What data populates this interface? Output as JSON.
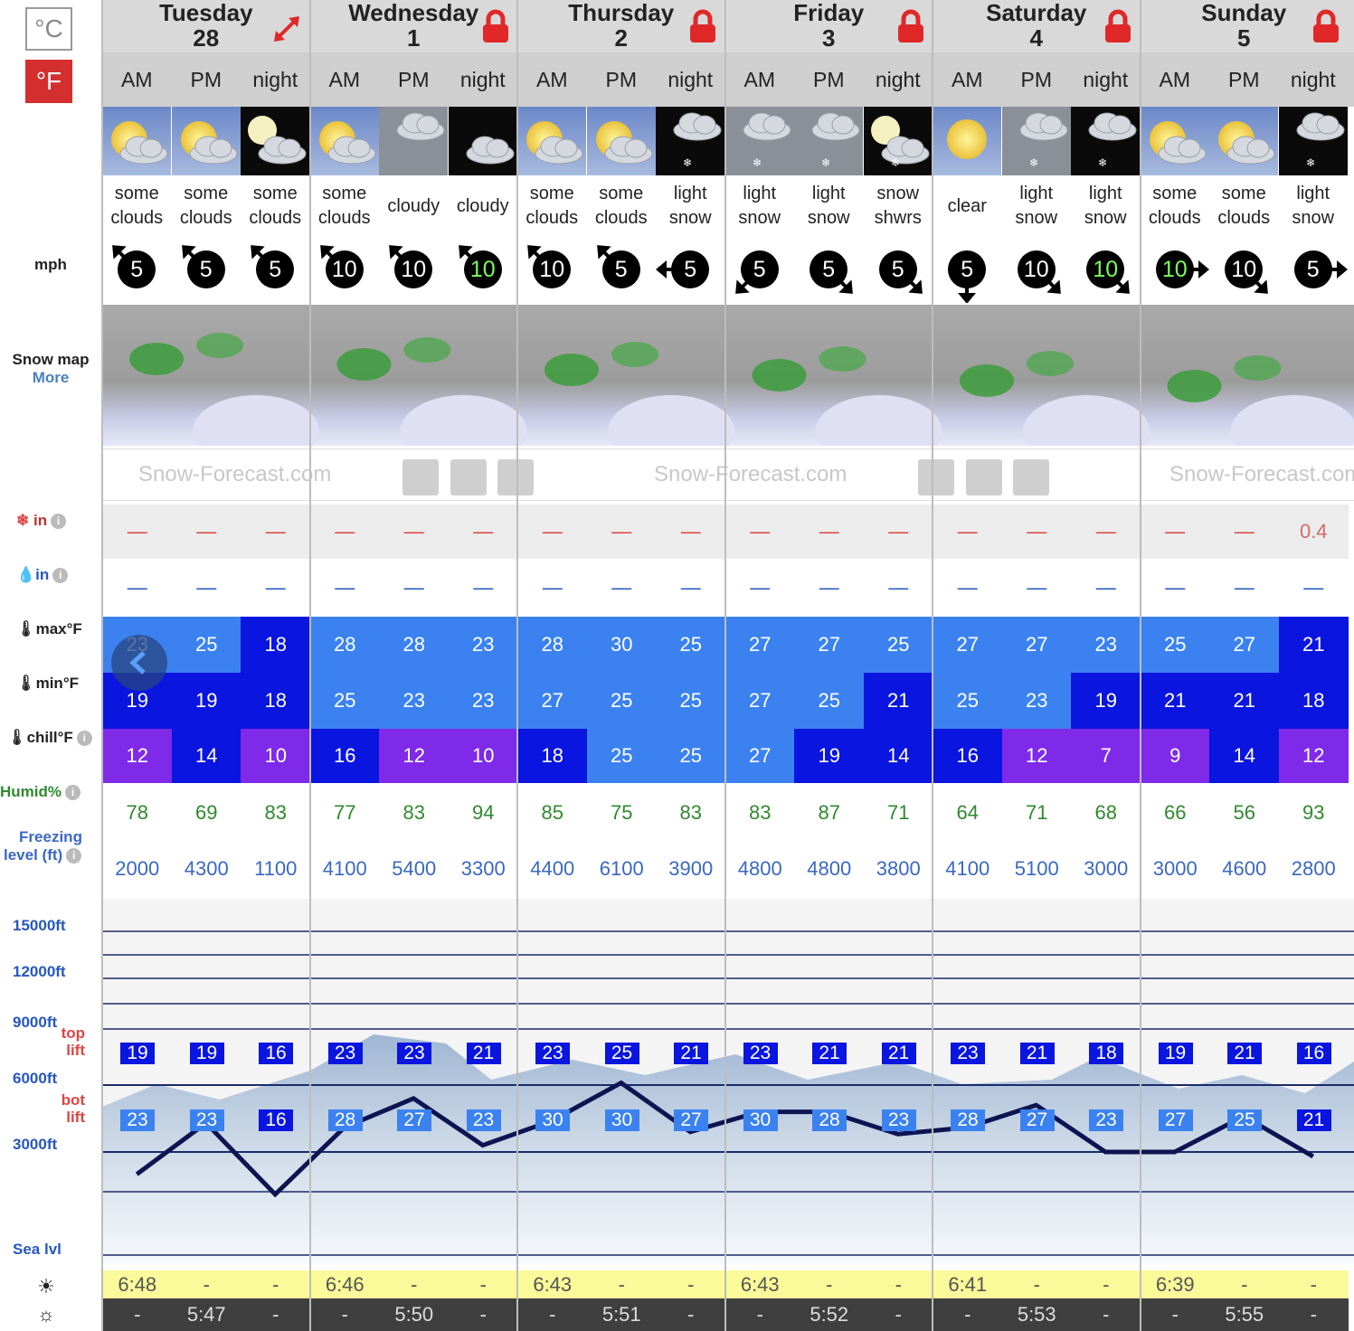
{
  "units": {
    "celsius": "°C",
    "fahrenheit": "°F",
    "active": "F"
  },
  "days": [
    {
      "name": "Tuesday",
      "date": "28",
      "locked": false,
      "expand": true
    },
    {
      "name": "Wednesday",
      "date": "1",
      "locked": true
    },
    {
      "name": "Thursday",
      "date": "2",
      "locked": true
    },
    {
      "name": "Friday",
      "date": "3",
      "locked": true
    },
    {
      "name": "Saturday",
      "date": "4",
      "locked": true
    },
    {
      "name": "Sunday",
      "date": "5",
      "locked": true
    }
  ],
  "periods": [
    "AM",
    "PM",
    "night",
    "AM",
    "PM",
    "night",
    "AM",
    "PM",
    "night",
    "AM",
    "PM",
    "night",
    "AM",
    "PM",
    "night",
    "AM",
    "PM",
    "night"
  ],
  "weather": [
    {
      "l1": "some",
      "l2": "clouds",
      "icon": "sun-clouds-icon"
    },
    {
      "l1": "some",
      "l2": "clouds",
      "icon": "sun-clouds-icon"
    },
    {
      "l1": "some",
      "l2": "clouds",
      "icon": "moon-clouds-icon"
    },
    {
      "l1": "some",
      "l2": "clouds",
      "icon": "sun-clouds-icon"
    },
    {
      "l1": "cloudy",
      "l2": "",
      "icon": "cloud-icon"
    },
    {
      "l1": "cloudy",
      "l2": "",
      "icon": "cloud-night-icon"
    },
    {
      "l1": "some",
      "l2": "clouds",
      "icon": "sun-clouds-icon"
    },
    {
      "l1": "some",
      "l2": "clouds",
      "icon": "sun-clouds-icon"
    },
    {
      "l1": "light",
      "l2": "snow",
      "icon": "snow-cloud-night-icon"
    },
    {
      "l1": "light",
      "l2": "snow",
      "icon": "snow-cloud-icon"
    },
    {
      "l1": "light",
      "l2": "snow",
      "icon": "snow-cloud-icon"
    },
    {
      "l1": "snow",
      "l2": "shwrs",
      "icon": "moon-snow-icon"
    },
    {
      "l1": "clear",
      "l2": "",
      "icon": "sun-icon"
    },
    {
      "l1": "light",
      "l2": "snow",
      "icon": "snow-cloud-icon"
    },
    {
      "l1": "light",
      "l2": "snow",
      "icon": "snow-cloud-night-icon"
    },
    {
      "l1": "some",
      "l2": "clouds",
      "icon": "sun-clouds-icon"
    },
    {
      "l1": "some",
      "l2": "clouds",
      "icon": "sun-clouds-icon"
    },
    {
      "l1": "light",
      "l2": "snow",
      "icon": "snow-cloud-night-icon"
    }
  ],
  "wind_unit": "mph",
  "wind": [
    {
      "v": "5",
      "dir": "nw",
      "c": "#fff"
    },
    {
      "v": "5",
      "dir": "nw",
      "c": "#fff"
    },
    {
      "v": "5",
      "dir": "nw",
      "c": "#fff"
    },
    {
      "v": "10",
      "dir": "nw",
      "c": "#fff"
    },
    {
      "v": "10",
      "dir": "nw",
      "c": "#fff"
    },
    {
      "v": "10",
      "dir": "nw",
      "c": "#7CFC5A"
    },
    {
      "v": "10",
      "dir": "nw",
      "c": "#fff"
    },
    {
      "v": "5",
      "dir": "nw",
      "c": "#fff"
    },
    {
      "v": "5",
      "dir": "w",
      "c": "#fff"
    },
    {
      "v": "5",
      "dir": "sw",
      "c": "#fff"
    },
    {
      "v": "5",
      "dir": "se",
      "c": "#fff"
    },
    {
      "v": "5",
      "dir": "se",
      "c": "#fff"
    },
    {
      "v": "5",
      "dir": "s",
      "c": "#fff"
    },
    {
      "v": "10",
      "dir": "se",
      "c": "#fff"
    },
    {
      "v": "10",
      "dir": "se",
      "c": "#7CFC5A"
    },
    {
      "v": "10",
      "dir": "e",
      "c": "#7CFC5A"
    },
    {
      "v": "10",
      "dir": "se",
      "c": "#fff"
    },
    {
      "v": "5",
      "dir": "e",
      "c": "#fff"
    }
  ],
  "snow_map": {
    "label": "Snow map",
    "more": "More",
    "watermark": "Snow-Forecast.com"
  },
  "rows": {
    "snow": {
      "label": "in",
      "values": [
        "—",
        "—",
        "—",
        "—",
        "—",
        "—",
        "—",
        "—",
        "—",
        "—",
        "—",
        "—",
        "—",
        "—",
        "—",
        "—",
        "—",
        "0.4"
      ]
    },
    "rain": {
      "label": "in",
      "values": [
        "—",
        "—",
        "—",
        "—",
        "—",
        "—",
        "—",
        "—",
        "—",
        "—",
        "—",
        "—",
        "—",
        "—",
        "—",
        "—",
        "—",
        "—"
      ]
    },
    "max": {
      "label": "max°F",
      "values": [
        "23",
        "25",
        "18",
        "28",
        "28",
        "23",
        "28",
        "30",
        "25",
        "27",
        "27",
        "25",
        "27",
        "27",
        "23",
        "25",
        "27",
        "21"
      ]
    },
    "min": {
      "label": "min°F",
      "values": [
        "19",
        "19",
        "18",
        "25",
        "23",
        "23",
        "27",
        "25",
        "25",
        "27",
        "25",
        "21",
        "25",
        "23",
        "19",
        "21",
        "21",
        "18"
      ]
    },
    "chill": {
      "label": "chill°F",
      "values": [
        "12",
        "14",
        "10",
        "16",
        "12",
        "10",
        "18",
        "25",
        "25",
        "27",
        "19",
        "14",
        "16",
        "12",
        "7",
        "9",
        "14",
        "12"
      ]
    },
    "humid": {
      "label": "Humid%",
      "values": [
        "78",
        "69",
        "83",
        "77",
        "83",
        "94",
        "85",
        "75",
        "83",
        "83",
        "87",
        "71",
        "64",
        "71",
        "68",
        "66",
        "56",
        "93"
      ]
    },
    "freeze": {
      "label1": "Freezing",
      "label2": "level (ft)",
      "values": [
        "2000",
        "4300",
        "1100",
        "4100",
        "5400",
        "3300",
        "4400",
        "6100",
        "3900",
        "4800",
        "4800",
        "3800",
        "4100",
        "5100",
        "3000",
        "3000",
        "4600",
        "2800"
      ]
    }
  },
  "altitude": {
    "labels": [
      "15000ft",
      "12000ft",
      "9000ft",
      "6000ft",
      "3000ft",
      "Sea lvl"
    ],
    "top_lift": [
      "top",
      "lift"
    ],
    "bot_lift": [
      "bot",
      "lift"
    ],
    "top_values": [
      "19",
      "19",
      "16",
      "23",
      "23",
      "21",
      "23",
      "25",
      "21",
      "23",
      "21",
      "21",
      "23",
      "21",
      "18",
      "19",
      "21",
      "16"
    ],
    "bot_values": [
      "23",
      "23",
      "16",
      "28",
      "27",
      "23",
      "30",
      "30",
      "27",
      "30",
      "28",
      "23",
      "28",
      "27",
      "23",
      "27",
      "25",
      "21"
    ]
  },
  "sunrise": [
    "6:48",
    "-",
    "-",
    "6:46",
    "-",
    "-",
    "6:43",
    "-",
    "-",
    "6:43",
    "-",
    "-",
    "6:41",
    "-",
    "-",
    "6:39",
    "-",
    "-"
  ],
  "sunset": [
    "-",
    "5:47",
    "-",
    "-",
    "5:50",
    "-",
    "-",
    "5:51",
    "-",
    "-",
    "5:52",
    "-",
    "-",
    "5:53",
    "-",
    "-",
    "5:55",
    "-"
  ],
  "colors": {
    "header": "#d9d9d9",
    "max_light": "#3b82f0",
    "max_dark": "#0a15e0",
    "chill_purple": "#7f2ae8",
    "humid": "#2f8a2f",
    "freeze": "#3a68c2",
    "sunrise": "#fafa9a",
    "sunset": "#3f3f3f",
    "fbtn": "#d42f2f"
  }
}
